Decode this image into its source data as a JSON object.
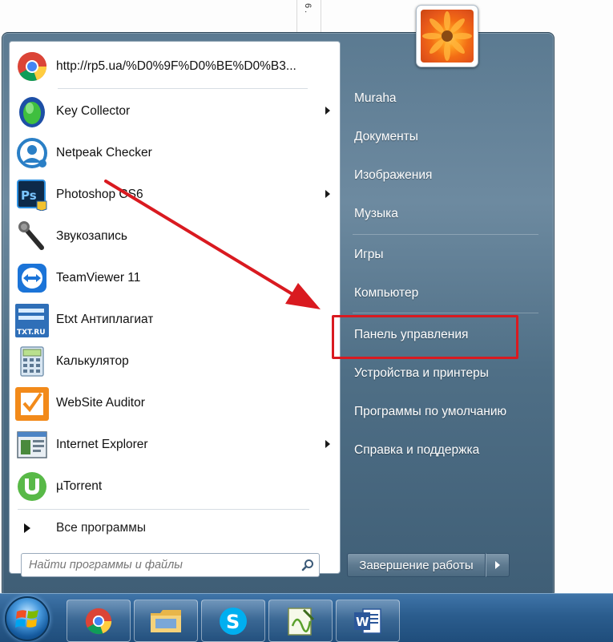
{
  "background": {
    "margin_mark": "6 ."
  },
  "programs": [
    {
      "label": "http://rp5.ua/%D0%9F%D0%BE%D0%B3...",
      "icon": "chrome-icon",
      "submenu": false
    },
    {
      "label": "Key Collector",
      "icon": "key-collector-icon",
      "submenu": true
    },
    {
      "label": "Netpeak Checker",
      "icon": "netpeak-checker-icon",
      "submenu": false
    },
    {
      "label": "Photoshop CS6",
      "icon": "photoshop-icon",
      "submenu": true
    },
    {
      "label": "Звукозапись",
      "icon": "microphone-icon",
      "submenu": false
    },
    {
      "label": "TeamViewer 11",
      "icon": "teamviewer-icon",
      "submenu": false
    },
    {
      "label": "Etxt Антиплагиат",
      "icon": "etxt-icon",
      "submenu": false
    },
    {
      "label": "Калькулятор",
      "icon": "calculator-icon",
      "submenu": false
    },
    {
      "label": "WebSite Auditor",
      "icon": "website-auditor-icon",
      "submenu": false
    },
    {
      "label": "Internet Explorer",
      "icon": "internet-explorer-icon",
      "submenu": true
    },
    {
      "label": "µTorrent",
      "icon": "utorrent-icon",
      "submenu": false
    }
  ],
  "all_programs": {
    "label": "Все программы"
  },
  "search": {
    "placeholder": "Найти программы и файлы"
  },
  "etxt_badge": "TXT.RU",
  "right_menu": {
    "items": [
      {
        "label": "Muraha"
      },
      {
        "label": "Документы"
      },
      {
        "label": "Изображения"
      },
      {
        "label": "Музыка"
      },
      {
        "label": "Игры"
      },
      {
        "label": "Компьютер"
      },
      {
        "label": "Панель управления"
      },
      {
        "label": "Устройства и принтеры"
      },
      {
        "label": "Программы по умолчанию"
      },
      {
        "label": "Справка и поддержка"
      }
    ],
    "highlighted": "Панель управления"
  },
  "shutdown": {
    "label": "Завершение работы"
  },
  "taskbar": {
    "pinned": [
      "chrome-icon",
      "file-explorer-icon",
      "skype-icon",
      "notepad-plus-plus-icon",
      "word-icon"
    ],
    "word_letter": "W",
    "skype_letter": "S"
  },
  "colors": {
    "annotation_red": "#d91a20",
    "menu_right_pane": "#5b7a91",
    "taskbar": "#2b5d8e"
  }
}
